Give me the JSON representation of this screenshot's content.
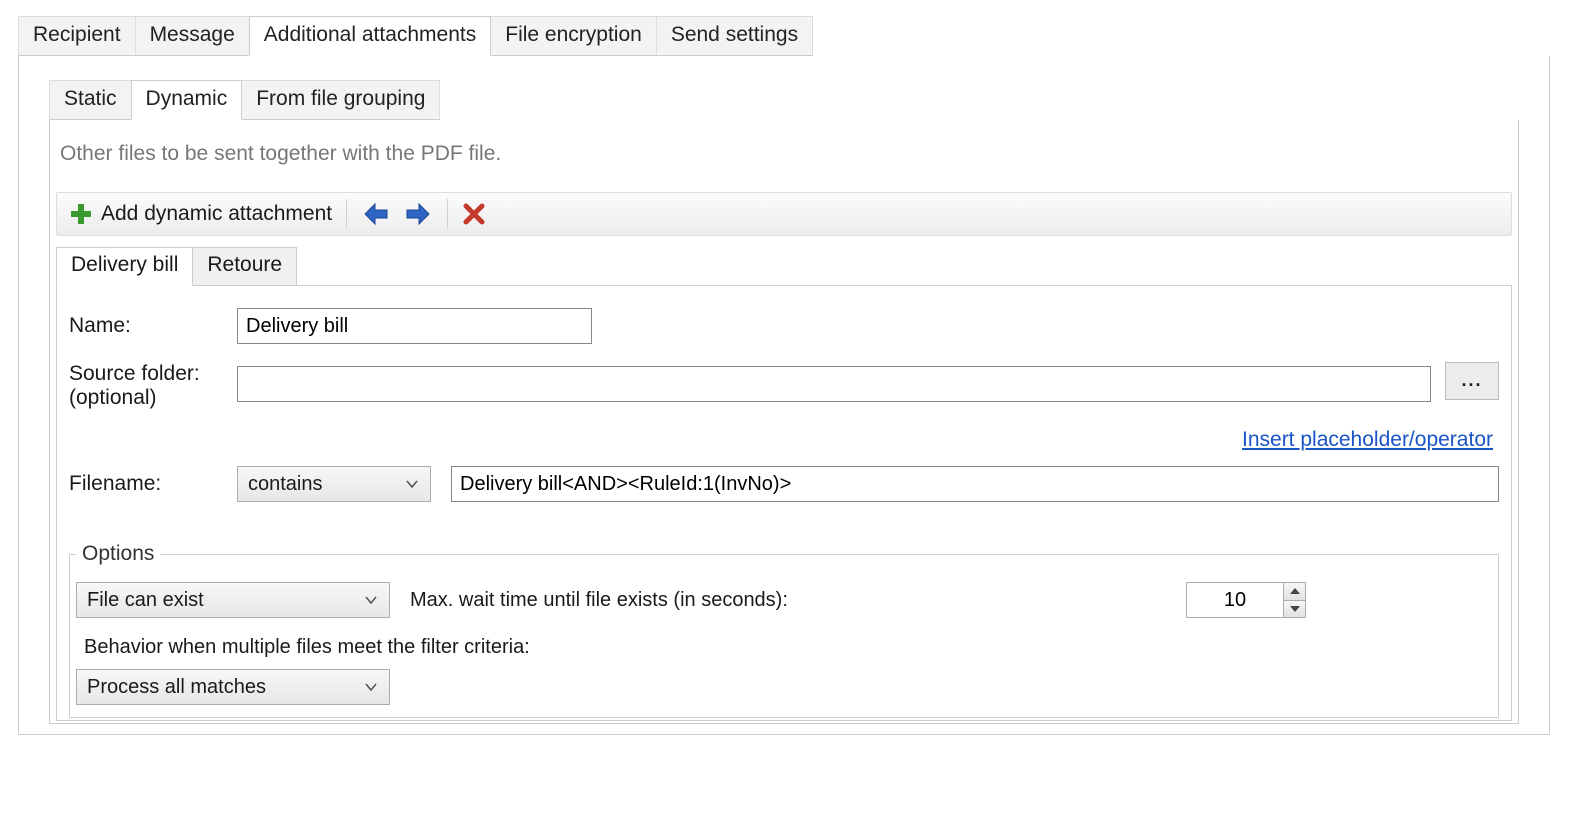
{
  "outer_tabs": {
    "recipient": "Recipient",
    "message": "Message",
    "attachments": "Additional attachments",
    "encryption": "File encryption",
    "send": "Send settings"
  },
  "inner_tabs": {
    "static": "Static",
    "dynamic": "Dynamic",
    "grouping": "From file grouping"
  },
  "dynamic_panel": {
    "description": "Other files to be sent together with the PDF file.",
    "toolbar": {
      "add_label": "Add dynamic attachment"
    },
    "attachment_tabs": {
      "item0": "Delivery bill",
      "item1": "Retoure"
    },
    "form": {
      "name_label": "Name:",
      "name_value": "Delivery bill",
      "source_label_line1": "Source folder:",
      "source_label_line2": "(optional)",
      "source_value": "",
      "browse_label": "...",
      "insert_link": "Insert placeholder/operator",
      "filename_label": "Filename:",
      "filename_op": "contains",
      "filename_value": "Delivery bill<AND><RuleId:1(InvNo)>"
    },
    "options": {
      "legend": "Options",
      "exist_select": "File can exist",
      "wait_label": "Max. wait time until file exists (in seconds):",
      "wait_value": "10",
      "multi_label": "Behavior when multiple files meet the filter criteria:",
      "multi_select": "Process all matches"
    }
  }
}
